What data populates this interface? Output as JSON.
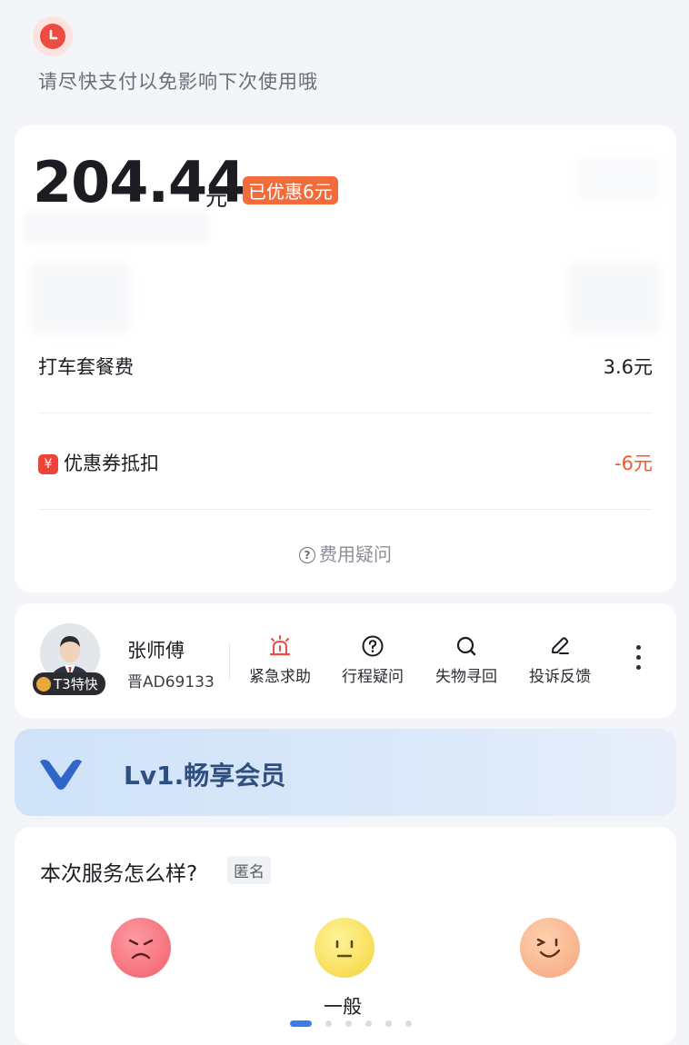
{
  "notice": {
    "text": "请尽快支付以免影响下次使用哦"
  },
  "fee": {
    "amount": "204.44",
    "currency": "元",
    "discount_badge": "已优惠6元",
    "items": [
      {
        "label": "打车套餐费",
        "value": "3.6元"
      },
      {
        "label": "优惠券抵扣",
        "value": "-6元",
        "icon": "coupon-icon",
        "icon_glyph": "¥"
      }
    ],
    "question_link": "费用疑问"
  },
  "driver": {
    "name": "张师傅",
    "plate": "晋AD69133",
    "badge": "T3特快",
    "actions": [
      {
        "label": "紧急求助",
        "icon": "alarm-icon"
      },
      {
        "label": "行程疑问",
        "icon": "question-icon"
      },
      {
        "label": "失物寻回",
        "icon": "search-icon"
      },
      {
        "label": "投诉反馈",
        "icon": "edit-icon"
      }
    ]
  },
  "member": {
    "level": "Lv1.畅享会员"
  },
  "rating": {
    "title": "本次服务怎么样?",
    "anonymous_tag": "匿名",
    "selected_label": "一般",
    "page_count": 6,
    "active_page": 1
  },
  "colors": {
    "accent_red": "#ee4c40",
    "discount_orange": "#f26b3a",
    "member_blue": "#2e4f80",
    "indicator_blue": "#3a7de8"
  }
}
